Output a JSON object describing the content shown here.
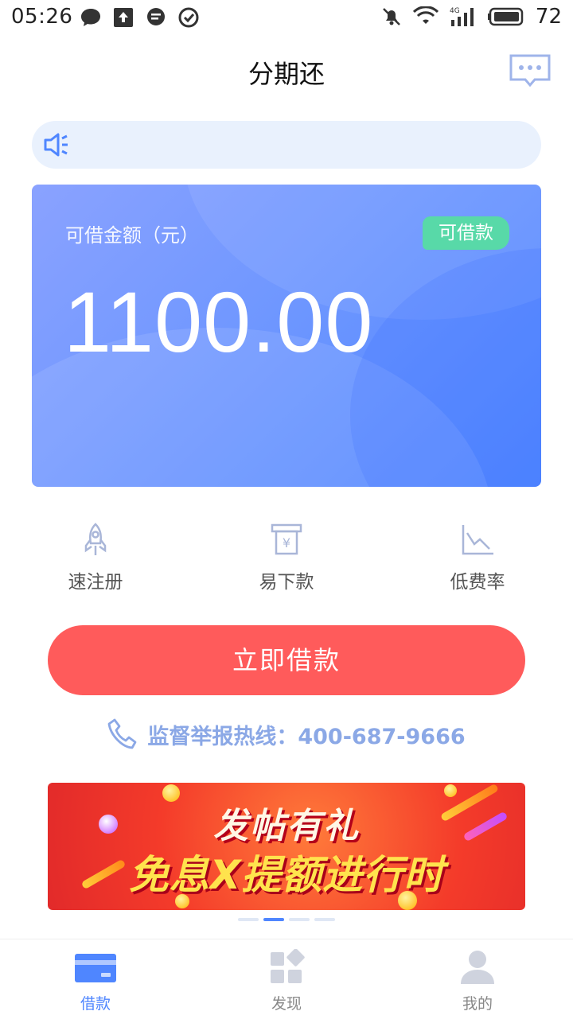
{
  "status_bar": {
    "time": "05:26",
    "battery": "72"
  },
  "header": {
    "title": "分期还"
  },
  "card": {
    "label": "可借金额（元）",
    "badge": "可借款",
    "amount": "1100.00"
  },
  "features": [
    {
      "label": "速注册",
      "icon": "rocket-icon"
    },
    {
      "label": "易下款",
      "icon": "atm-yuan-icon"
    },
    {
      "label": "低费率",
      "icon": "chart-down-icon"
    }
  ],
  "borrow_button": {
    "label": "立即借款"
  },
  "hotline": {
    "text": "监督举报热线：400-687-9666"
  },
  "banner": {
    "line1": "发帖有礼",
    "line2": "免息X提额进行时"
  },
  "nav": [
    {
      "label": "借款",
      "active": true
    },
    {
      "label": "发现",
      "active": false
    },
    {
      "label": "我的",
      "active": false
    }
  ],
  "colors": {
    "accent": "#4f86ff",
    "button": "#ff5b5b",
    "badge": "#58d9a8",
    "notice_bg": "#e9f1fd",
    "hotline_text": "#8ba8e6"
  }
}
